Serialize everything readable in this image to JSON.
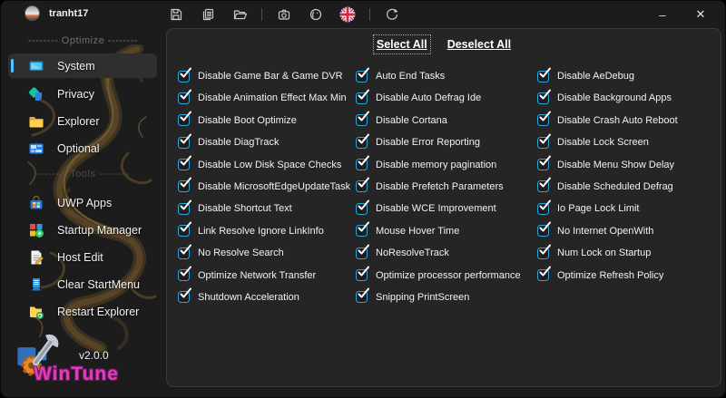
{
  "titlebar": {
    "username": "tranht17",
    "icons": [
      "save",
      "copy",
      "open-folder",
      "screenshot",
      "theme",
      "language-english-flag",
      "refresh"
    ],
    "window_controls": {
      "minimize": "–",
      "close": "✕"
    }
  },
  "sidebar": {
    "section_optimize": "-------- Optimize --------",
    "section_tools": "-------- Tools --------",
    "items": [
      {
        "label": "System",
        "icon": "system-monitor-icon",
        "selected": true
      },
      {
        "label": "Privacy",
        "icon": "privacy-icon",
        "selected": false
      },
      {
        "label": "Explorer",
        "icon": "explorer-folder-icon",
        "selected": false
      },
      {
        "label": "Optional",
        "icon": "optional-panel-icon",
        "selected": false
      },
      {
        "label": "UWP Apps",
        "icon": "uwp-store-icon",
        "selected": false
      },
      {
        "label": "Startup Manager",
        "icon": "startup-manager-icon",
        "selected": false
      },
      {
        "label": "Host Edit",
        "icon": "host-edit-icon",
        "selected": false
      },
      {
        "label": "Clear StartMenu",
        "icon": "clear-startmenu-icon",
        "selected": false
      },
      {
        "label": "Restart Explorer",
        "icon": "restart-explorer-icon",
        "selected": false
      }
    ],
    "footer": {
      "version": "v2.0.0",
      "brand": "WinTune"
    }
  },
  "main": {
    "select_all": "Select All",
    "deselect_all": "Deselect All",
    "all_checked": true,
    "columns": [
      {
        "items": [
          "Disable Game Bar & Game DVR",
          "Disable Animation Effect Max Min",
          "Disable Boot Optimize",
          "Disable DiagTrack",
          "Disable Low Disk Space Checks",
          "Disable MicrosoftEdgeUpdateTask",
          "Disable Shortcut Text",
          "Link Resolve Ignore LinkInfo",
          "No Resolve Search",
          "Optimize Network Transfer",
          "Shutdown Acceleration"
        ]
      },
      {
        "items": [
          "Auto End Tasks",
          "Disable Auto Defrag Ide",
          "Disable Cortana",
          "Disable Error Reporting",
          "Disable memory pagination",
          "Disable Prefetch Parameters",
          "Disable WCE Improvement",
          "Mouse Hover Time",
          "NoResolveTrack",
          "Optimize processor performance",
          "Snipping PrintScreen"
        ]
      },
      {
        "items": [
          "Disable AeDebug",
          "Disable Background Apps",
          "Disable Crash Auto Reboot",
          "Disable Lock Screen",
          "Disable Menu Show Delay",
          "Disable Scheduled Defrag",
          "Io Page Lock Limit",
          "No Internet OpenWith",
          "Num Lock on Startup",
          "Optimize Refresh Policy"
        ]
      }
    ]
  },
  "colors": {
    "accent": "#2aa7e0",
    "selection_pill": "#4cc2ff",
    "brand_magenta": "#e23bbf"
  }
}
